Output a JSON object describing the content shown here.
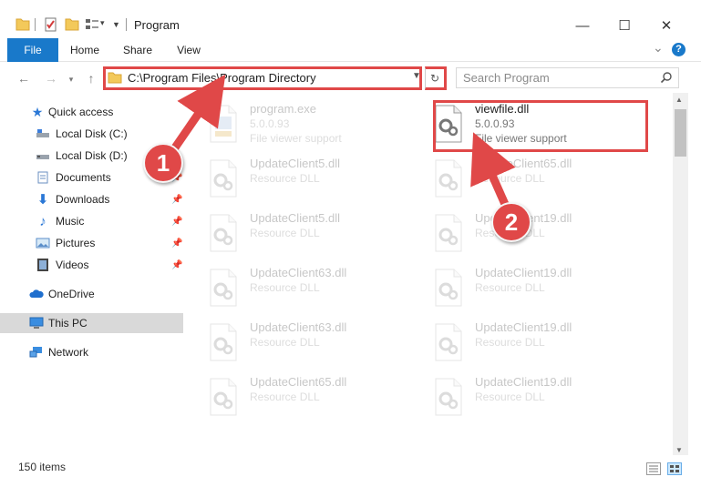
{
  "window": {
    "title": "Program",
    "minimize": "—",
    "maximize": "☐",
    "close": "✕"
  },
  "ribbon": {
    "tabs": [
      "File",
      "Home",
      "Share",
      "View"
    ],
    "expand": "⌄",
    "help": "?"
  },
  "address": {
    "path": "C:\\Program Files\\Program Directory",
    "search_placeholder": "Search Program"
  },
  "nav": {
    "items": [
      {
        "label": "Quick access",
        "icon": "star-icon",
        "pinned": false
      },
      {
        "label": "Local Disk (C:)",
        "icon": "drive-icon",
        "pinned": false
      },
      {
        "label": "Local Disk (D:)",
        "icon": "drive-icon",
        "pinned": false
      },
      {
        "label": "Documents",
        "icon": "documents-icon",
        "pinned": true
      },
      {
        "label": "Downloads",
        "icon": "downloads-icon",
        "pinned": true
      },
      {
        "label": "Music",
        "icon": "music-icon",
        "pinned": true
      },
      {
        "label": "Pictures",
        "icon": "pictures-icon",
        "pinned": true
      },
      {
        "label": "Videos",
        "icon": "videos-icon",
        "pinned": true
      },
      {
        "label": "OneDrive",
        "icon": "cloud-icon",
        "pinned": false
      },
      {
        "label": "This PC",
        "icon": "computer-icon",
        "pinned": false
      },
      {
        "label": "Network",
        "icon": "network-icon",
        "pinned": false
      }
    ]
  },
  "files": [
    {
      "name": "program.exe",
      "line2": "5.0.0.93",
      "line3": "File viewer support",
      "faded": true
    },
    {
      "name": "viewfile.dll",
      "line2": "5.0.0.93",
      "line3": "File viewer support",
      "faded": false
    },
    {
      "name": "UpdateClient5.dll",
      "line2": "Resource DLL",
      "line3": "",
      "faded": true
    },
    {
      "name": "UpdateClient65.dll",
      "line2": "Resource DLL",
      "line3": "",
      "faded": true
    },
    {
      "name": "UpdateClient5.dll",
      "line2": "Resource DLL",
      "line3": "",
      "faded": true
    },
    {
      "name": "UpdateClient19.dll",
      "line2": "Resource DLL",
      "line3": "",
      "faded": true
    },
    {
      "name": "UpdateClient63.dll",
      "line2": "Resource DLL",
      "line3": "",
      "faded": true
    },
    {
      "name": "UpdateClient19.dll",
      "line2": "Resource DLL",
      "line3": "",
      "faded": true
    },
    {
      "name": "UpdateClient63.dll",
      "line2": "Resource DLL",
      "line3": "",
      "faded": true
    },
    {
      "name": "UpdateClient19.dll",
      "line2": "Resource DLL",
      "line3": "",
      "faded": true
    },
    {
      "name": "UpdateClient65.dll",
      "line2": "Resource DLL",
      "line3": "",
      "faded": true
    },
    {
      "name": "UpdateClient19.dll",
      "line2": "Resource DLL",
      "line3": "",
      "faded": true
    }
  ],
  "status": {
    "item_count": "150 items"
  },
  "annotations": {
    "step1": "1",
    "step2": "2",
    "color": "#e04848"
  },
  "colors": {
    "accent": "#1979ca",
    "highlight": "#e04848"
  }
}
